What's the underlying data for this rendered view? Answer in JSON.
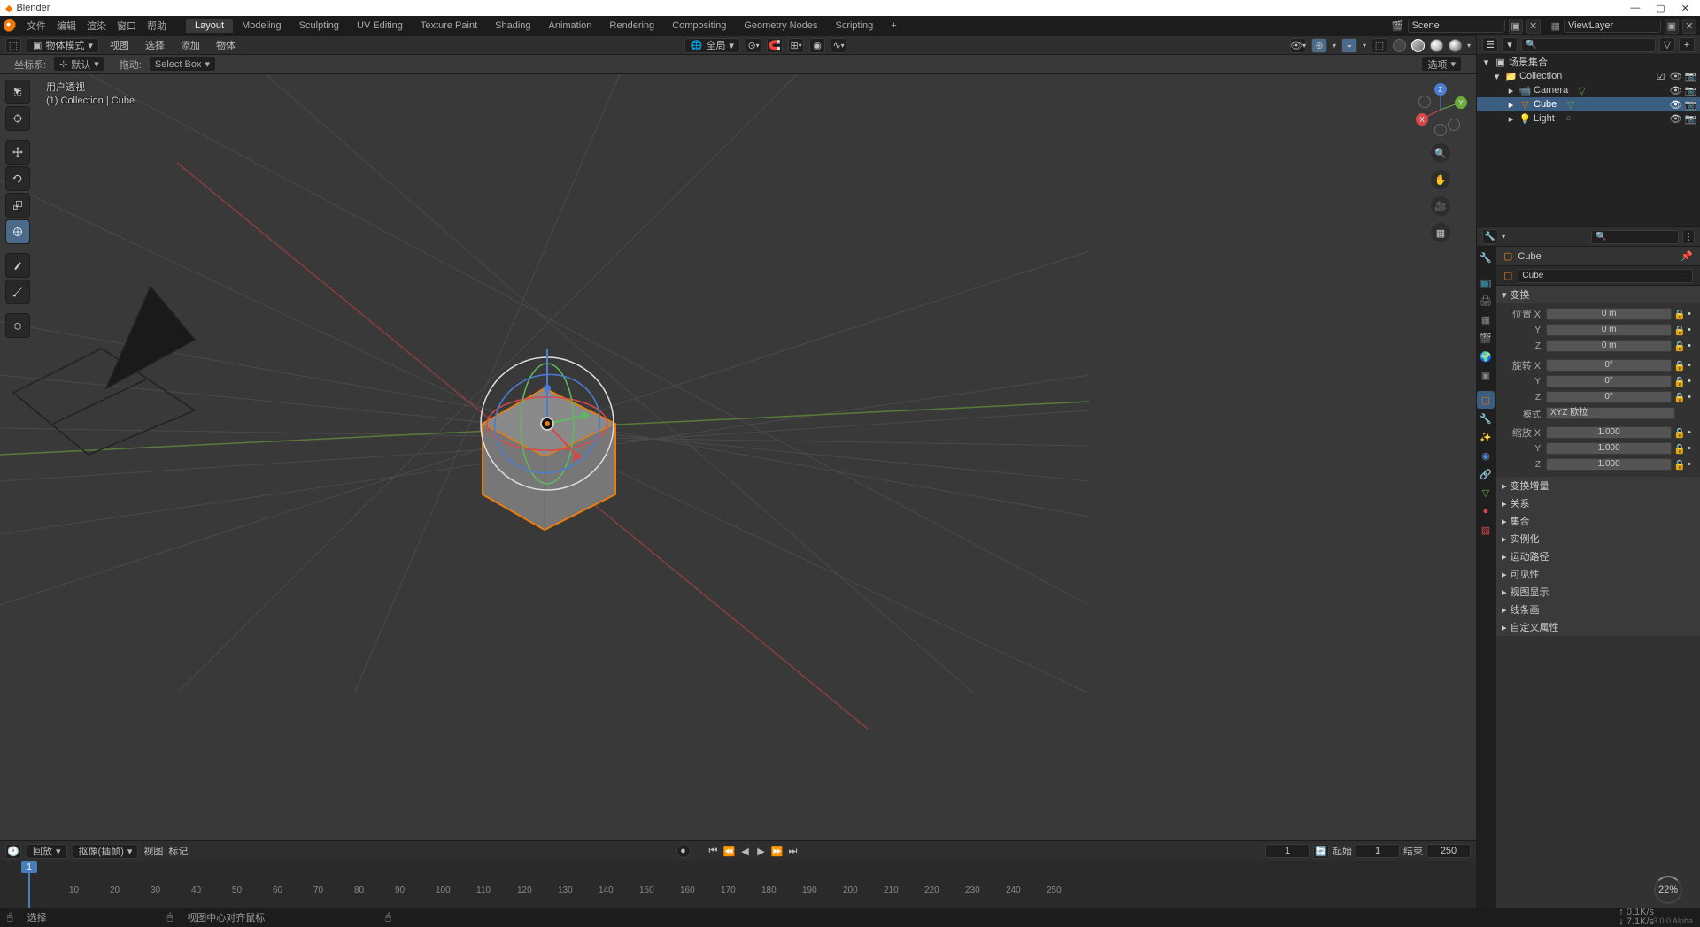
{
  "app": {
    "title": "Blender"
  },
  "menus": {
    "file": "文件",
    "edit": "编辑",
    "render": "渲染",
    "window": "窗口",
    "help": "帮助"
  },
  "workspaces": {
    "items": [
      "Layout",
      "Modeling",
      "Sculpting",
      "UV Editing",
      "Texture Paint",
      "Shading",
      "Animation",
      "Rendering",
      "Compositing",
      "Geometry Nodes",
      "Scripting"
    ],
    "active": 0
  },
  "top_right": {
    "scene_label": "Scene",
    "viewlayer_label": "ViewLayer"
  },
  "vp_header": {
    "mode": "物体模式",
    "menus": [
      "视图",
      "选择",
      "添加",
      "物体"
    ],
    "global_dropdown": "全局",
    "options": "选项"
  },
  "toolopt": {
    "coord_label": "坐标系:",
    "coord_value": "默认",
    "drag_label": "拖动:",
    "drag_value": "Select Box"
  },
  "vp_info": {
    "l1": "用户透视",
    "l2": "(1) Collection | Cube"
  },
  "nav_axes": {
    "x": "X",
    "y": "Y",
    "z": "Z"
  },
  "timeline": {
    "play_label": "回放",
    "keying_label": "抠像(插帧)",
    "view": "视图",
    "mark": "标记",
    "current": "1",
    "start_label": "起始",
    "start": "1",
    "end_label": "结束",
    "end": "250",
    "ticks": [
      "10",
      "20",
      "30",
      "40",
      "50",
      "60",
      "70",
      "80",
      "90",
      "100",
      "110",
      "120",
      "130",
      "140",
      "150",
      "160",
      "170",
      "180",
      "190",
      "200",
      "210",
      "220",
      "230",
      "240",
      "250"
    ],
    "playhead": "1"
  },
  "status": {
    "left1": "选择",
    "left2": "视图中心对齐鼠标",
    "rate1": "0.1K/s",
    "rate2": "7.1K/s",
    "battery": "22%",
    "version": "3.0.0 Alpha"
  },
  "outliner": {
    "root": "场景集合",
    "collection": "Collection",
    "items": [
      {
        "name": "Camera",
        "icon": "camera"
      },
      {
        "name": "Cube",
        "icon": "mesh",
        "selected": true
      },
      {
        "name": "Light",
        "icon": "light"
      }
    ]
  },
  "properties": {
    "breadcrumb": "Cube",
    "datablock": "Cube",
    "panel_transform": "变换",
    "panels": [
      "变换增量",
      "关系",
      "集合",
      "实例化",
      "运动路径",
      "可见性",
      "视图显示",
      "线条画",
      "自定义属性"
    ],
    "position": {
      "label": "位置",
      "x": "0 m",
      "y": "0 m",
      "z": "0 m"
    },
    "rotation": {
      "label": "旋转",
      "x": "0°",
      "y": "0°",
      "z": "0°",
      "mode_label": "模式",
      "mode": "XYZ 欧拉"
    },
    "scale": {
      "label": "缩放",
      "x": "1.000",
      "y": "1.000",
      "z": "1.000"
    },
    "axes": {
      "x": "X",
      "y": "Y",
      "z": "Z"
    }
  }
}
